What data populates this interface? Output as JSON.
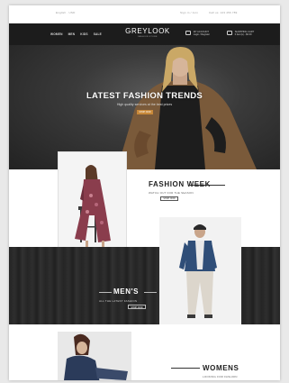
{
  "topbar": {
    "left_text": "English · USD",
    "right_text": "Sign in / Join",
    "right_text2": "Call us: 123 456 789"
  },
  "nav": {
    "links": [
      "WOMEN",
      "MEN",
      "KIDS",
      "SALE"
    ],
    "logo": "GREYLOOK",
    "logo_sub": "FASHION STORE",
    "account_line1": "MY ACCOUNT",
    "account_line2": "Login / Register",
    "cart_line1": "SHOPPING CART",
    "cart_line2": "0 item(s) - $0.00"
  },
  "hero": {
    "title": "LATEST FASHION TRENDS",
    "subtitle": "High quality services at the best prices",
    "button": "SHOP NOW"
  },
  "fashion_week": {
    "title": "FASHION WEEK",
    "subtitle": "WATCH OUT FOR THE SEASON",
    "button": "SHOP NOW"
  },
  "mens": {
    "title": "MEN'S",
    "subtitle": "ALL THE LATEST FASHION",
    "button": "SHOP NOW"
  },
  "womens": {
    "title": "WOMENS",
    "subtitle": "LOOKING FOR FASHION"
  },
  "colors": {
    "accent": "#c8893a",
    "nav_bg": "#1c1c1c",
    "dark_section": "#2a2a2a"
  }
}
